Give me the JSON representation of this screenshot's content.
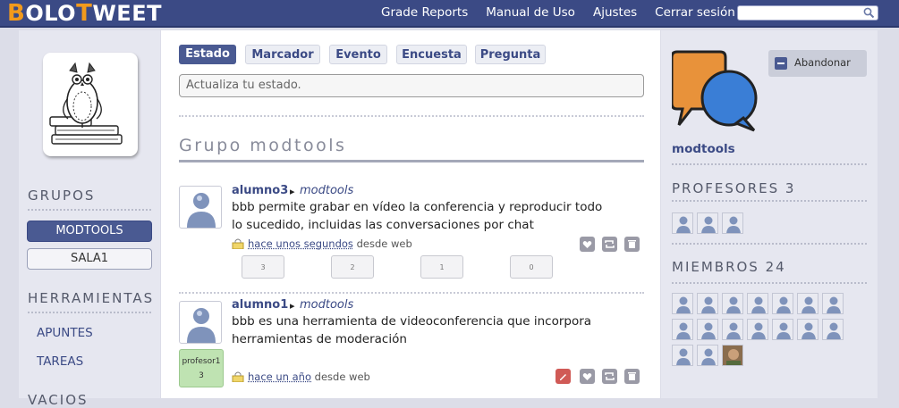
{
  "app": {
    "logo_parts": [
      "B",
      "OLO",
      "T",
      "WEET"
    ]
  },
  "nav": [
    "Grade Reports",
    "Manual de Uso",
    "Ajustes",
    "Cerrar sesión"
  ],
  "search": {
    "placeholder": ""
  },
  "left": {
    "groups_title": "GRUPOS",
    "groups": [
      "MODTOOLS",
      "SALA1"
    ],
    "tools_title": "HERRAMIENTAS",
    "tools": [
      "APUNTES",
      "TAREAS"
    ],
    "more_title": "VACIOS"
  },
  "composer": {
    "tabs": [
      "Estado",
      "Marcador",
      "Evento",
      "Encuesta",
      "Pregunta"
    ],
    "placeholder": "Actualiza tu estado."
  },
  "group_title": "Grupo modtools",
  "posts": [
    {
      "author": "alumno3",
      "arrow": "▸",
      "group": "modtools",
      "text": "bbb permite grabar en vídeo la conferencia y reproducir todo lo sucedido, incluidas las conversaciones por chat",
      "time": "hace unos segundos",
      "via": "desde web",
      "votes": [
        "3",
        "2",
        "1",
        "0"
      ]
    },
    {
      "author": "alumno1",
      "arrow": "▸",
      "group": "modtools",
      "text": "bbb es una herramienta de videoconferencia que incorpora herramientas de moderación",
      "time": "hace un año",
      "via": "desde web",
      "badge": {
        "label": "profesor1",
        "count": "3"
      }
    }
  ],
  "right": {
    "leave_label": "Abandonar",
    "group_name": "modtools",
    "teachers_title": "PROFESORES",
    "teachers_count": "3",
    "members_title": "MIEMBROS",
    "members_count": "24"
  },
  "colors": {
    "topbar": "#3b4a85",
    "logo_accent": "#f29a1c",
    "link": "#3b4a85",
    "active_btn": "#4a5a92"
  }
}
